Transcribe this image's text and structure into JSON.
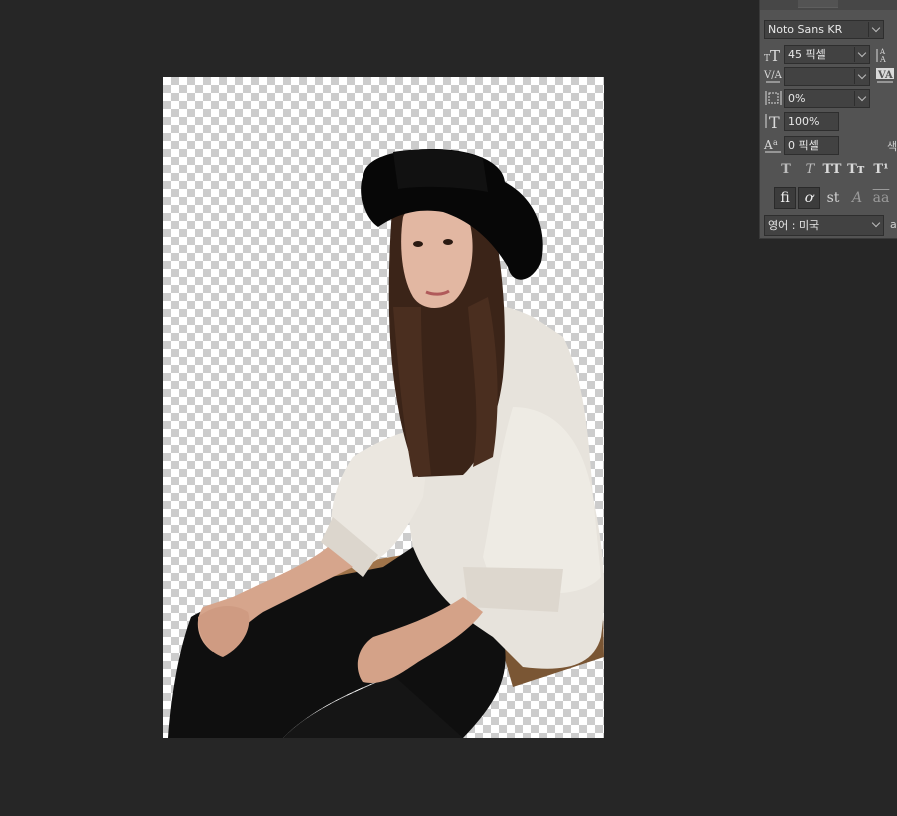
{
  "character_panel": {
    "font_family": "Noto Sans KR",
    "font_size": "45 픽셀",
    "kerning": "",
    "tsume": "0%",
    "vertical_scale": "100%",
    "baseline_shift": "0 픽셀",
    "color_label": "색",
    "language": "영어 : 미국",
    "aa_label": "a",
    "kerning_metric_label": "VA",
    "style_buttons": [
      "T",
      "T",
      "TT",
      "Tт",
      "T¹"
    ],
    "feature_buttons": [
      "fi",
      "ơ",
      "st",
      "A",
      "aa"
    ]
  },
  "colors": {
    "workspace_bg": "#262626",
    "panel_bg": "#535353",
    "field_bg": "#424242",
    "checker_light": "#ffffff",
    "checker_dark": "#cccccc"
  },
  "canvas": {
    "content": "cut-out photo of a woman in a black hat, white shirt and black trousers on a transparent background"
  }
}
